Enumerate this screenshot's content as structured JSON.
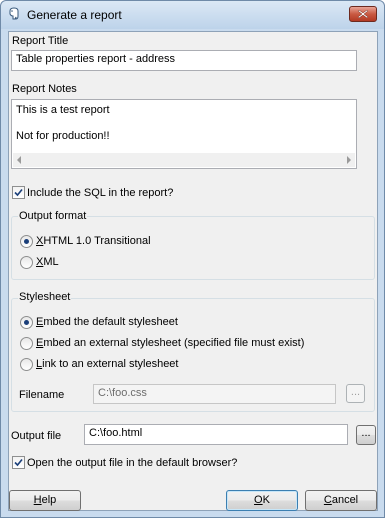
{
  "window": {
    "title": "Generate a report"
  },
  "report_title": {
    "label": "Report Title",
    "value": "Table properties report - address"
  },
  "report_notes": {
    "label": "Report Notes",
    "lines": [
      "This is a test report",
      "",
      "Not for production!!"
    ]
  },
  "include_sql": {
    "label": "Include the SQL in the report?",
    "checked": true
  },
  "output_format": {
    "title": "Output format",
    "options": [
      {
        "mnemonic": "X",
        "rest": "HTML 1.0 Transitional",
        "selected": true
      },
      {
        "mnemonic": "X",
        "rest": "ML",
        "selected": false
      }
    ]
  },
  "stylesheet": {
    "title": "Stylesheet",
    "options": [
      {
        "mnemonic": "E",
        "rest": "mbed the default stylesheet",
        "selected": true
      },
      {
        "mnemonic": "E",
        "rest": "mbed an external stylesheet (specified file must exist)",
        "selected": false
      },
      {
        "mnemonic": "L",
        "rest": "ink to an external stylesheet",
        "selected": false
      }
    ],
    "filename_label": "Filename",
    "filename_value": "C:\\foo.css",
    "browse_label": "..."
  },
  "output_file": {
    "label": "Output file",
    "value": "C:\\foo.html",
    "browse_label": "..."
  },
  "open_browser": {
    "label": "Open the output file in the default browser?",
    "checked": true
  },
  "buttons": {
    "help": {
      "mnemonic": "H",
      "rest": "elp"
    },
    "ok": {
      "mnemonic": "O",
      "rest": "K"
    },
    "cancel": {
      "mnemonic": "C",
      "rest": "ancel"
    }
  }
}
